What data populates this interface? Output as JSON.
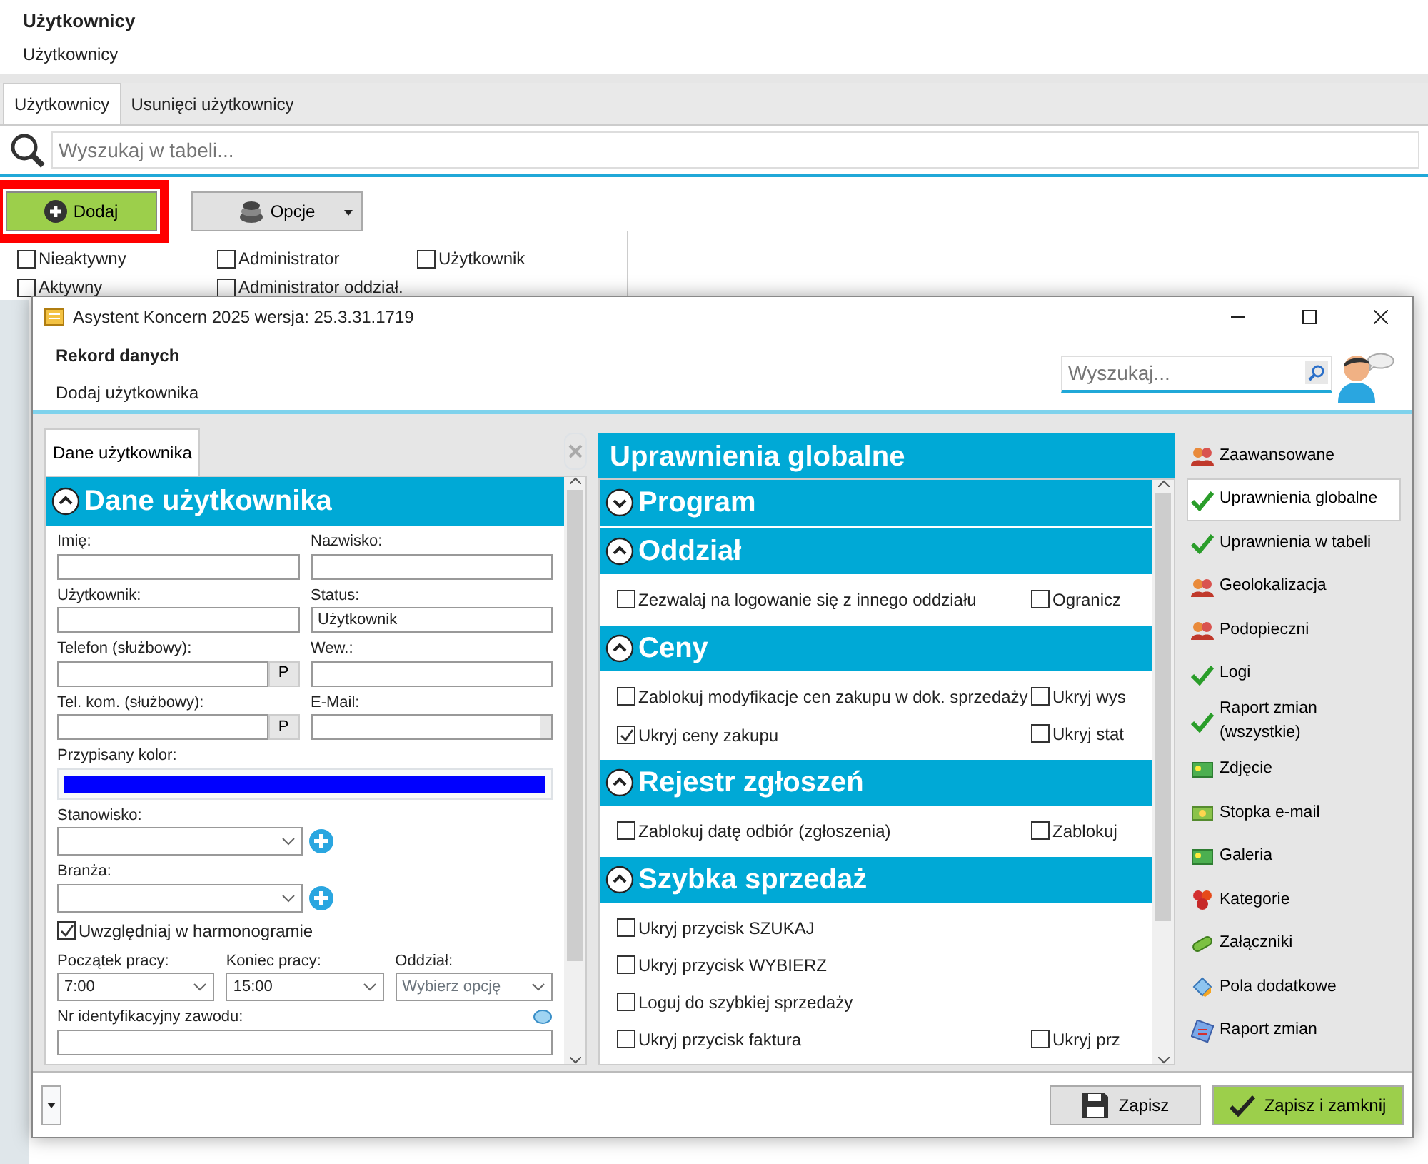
{
  "page": {
    "title": "Użytkownicy",
    "subtitle": "Użytkownicy"
  },
  "tabs": [
    {
      "label": "Użytkownicy",
      "selected": true
    },
    {
      "label": "Usunięci użytkownicy",
      "selected": false
    }
  ],
  "search": {
    "placeholder": "Wyszukaj w tabeli..."
  },
  "toolbar": {
    "add": {
      "label": "Dodaj",
      "highlighted": true
    },
    "options": {
      "label": "Opcje"
    }
  },
  "filters": [
    {
      "label": "Nieaktywny",
      "checked": false
    },
    {
      "label": "Administrator",
      "checked": false
    },
    {
      "label": "Użytkownik",
      "checked": false
    },
    {
      "label": "Aktywny",
      "checked": false
    },
    {
      "label": "Administrator oddział.",
      "checked": false
    }
  ],
  "dialog": {
    "title": "Asystent Koncern 2025 wersja: 25.3.31.1719",
    "heading": "Rekord danych",
    "subheading": "Dodaj użytkownika",
    "search": {
      "placeholder": "Wyszukaj..."
    },
    "form_tabs": [
      {
        "label": "Dane użytkownika",
        "selected": true
      }
    ],
    "form": {
      "title": "Dane użytkownika",
      "expanded": true,
      "rows": [
        [
          {
            "kind": "text",
            "label": "Imię:"
          },
          {
            "kind": "text",
            "label": "Nazwisko:"
          }
        ],
        [
          {
            "kind": "text",
            "label": "Użytkownik:"
          },
          {
            "kind": "text",
            "label": "Status:",
            "value": "Użytkownik"
          }
        ],
        [
          {
            "kind": "phone",
            "label": "Telefon (służbowy):",
            "button": "P"
          },
          {
            "kind": "text",
            "label": "Wew.:"
          }
        ],
        [
          {
            "kind": "phone",
            "label": "Tel. kom. (służbowy):",
            "button": "P"
          },
          {
            "kind": "email",
            "label": "E-Mail:"
          }
        ],
        [
          {
            "kind": "color",
            "label": "Przypisany kolor:",
            "color": "#0000ff"
          }
        ],
        [
          {
            "kind": "select-add",
            "label": "Stanowisko:"
          }
        ],
        [
          {
            "kind": "select-add",
            "label": "Branża:"
          }
        ],
        [
          {
            "kind": "checkbox",
            "label": "Uwzględniaj w harmonogramie",
            "checked": true
          }
        ],
        [
          {
            "kind": "select",
            "label": "Początek pracy:",
            "value": "7:00"
          },
          {
            "kind": "select",
            "label": "Koniec pracy:",
            "value": "15:00"
          },
          {
            "kind": "select",
            "label": "Oddział:",
            "placeholder": "Wybierz opcję"
          }
        ],
        [
          {
            "kind": "text-info",
            "label": "Nr identyfikacyjny zawodu:"
          }
        ]
      ]
    },
    "permissions": {
      "title": "Uprawnienia globalne",
      "sections": [
        {
          "title": "Program",
          "expanded": false
        },
        {
          "title": "Oddział",
          "expanded": true,
          "rows": [
            [
              {
                "label": "Zezwalaj na logowanie się z innego oddziału",
                "checked": false
              },
              {
                "label": "Ogranicz",
                "checked": false
              }
            ]
          ]
        },
        {
          "title": "Ceny",
          "expanded": true,
          "rows": [
            [
              {
                "label": "Zablokuj modyfikacje cen zakupu w dok. sprzedaży",
                "checked": false
              },
              {
                "label": "Ukryj wys",
                "checked": false
              }
            ],
            [
              {
                "label": "Ukryj ceny zakupu",
                "checked": true
              },
              {
                "label": "Ukryj stat",
                "checked": false
              }
            ]
          ]
        },
        {
          "title": "Rejestr zgłoszeń",
          "expanded": true,
          "rows": [
            [
              {
                "label": "Zablokuj datę odbiór (zgłoszenia)",
                "checked": false
              },
              {
                "label": "Zablokuj",
                "checked": false
              }
            ]
          ]
        },
        {
          "title": "Szybka sprzedaż",
          "expanded": true,
          "rows": [
            [
              {
                "label": "Ukryj przycisk SZUKAJ",
                "checked": false
              }
            ],
            [
              {
                "label": "Ukryj przycisk WYBIERZ",
                "checked": false
              }
            ],
            [
              {
                "label": "Loguj do szybkiej sprzedaży",
                "checked": false
              }
            ],
            [
              {
                "label": "Ukryj przycisk faktura",
                "checked": false
              },
              {
                "label": "Ukryj prz",
                "checked": false
              }
            ]
          ]
        }
      ]
    },
    "nav": [
      {
        "label": "Zaawansowane",
        "kind": "people",
        "selected": false
      },
      {
        "label": "Uprawnienia globalne",
        "kind": "check",
        "selected": true
      },
      {
        "label": "Uprawnienia w tabeli",
        "kind": "check",
        "selected": false
      },
      {
        "label": "Geolokalizacja",
        "kind": "people",
        "selected": false
      },
      {
        "label": "Podopieczni",
        "kind": "people",
        "selected": false
      },
      {
        "label": "Logi",
        "kind": "check",
        "selected": false
      },
      {
        "label": "Raport zmian (wszystkie)",
        "kind": "check",
        "selected": false
      },
      {
        "label": "Zdjęcie",
        "kind": "image",
        "selected": false
      },
      {
        "label": "Stopka e-mail",
        "kind": "money",
        "selected": false
      },
      {
        "label": "Galeria",
        "kind": "image",
        "selected": false
      },
      {
        "label": "Kategorie",
        "kind": "group",
        "selected": false
      },
      {
        "label": "Załączniki",
        "kind": "clip",
        "selected": false
      },
      {
        "label": "Pola dodatkowe",
        "kind": "tag",
        "selected": false
      },
      {
        "label": "Raport zmian",
        "kind": "report",
        "selected": false
      }
    ],
    "footer": {
      "save": "Zapisz",
      "save_close": "Zapisz i zamknij"
    }
  }
}
